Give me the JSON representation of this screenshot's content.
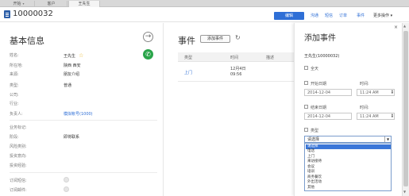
{
  "tabs": [
    {
      "label": "开始",
      "caret": "▾"
    },
    {
      "label": "客户"
    },
    {
      "label": "王先生"
    }
  ],
  "header": {
    "record_id": "10000032",
    "edit_label": "编辑",
    "links": [
      "沟通",
      "短信",
      "订单",
      "事件"
    ],
    "more_label": "更多操作 ▾"
  },
  "basic_info": {
    "title": "基本信息",
    "fields": [
      {
        "label": "姓名:",
        "value": "王先生"
      },
      {
        "label": "所在地:",
        "value": "陕西 西安"
      },
      {
        "label": "来源:",
        "value": "朋友介绍"
      },
      {
        "label": "类型:",
        "value": "普通"
      },
      {
        "label": "公司:",
        "value": ""
      },
      {
        "label": "行业:",
        "value": ""
      },
      {
        "label": "负责人:",
        "value": "模拟帐号(1000)"
      }
    ],
    "business_fields": [
      {
        "label": "业务标记:",
        "value": ""
      },
      {
        "label": "阶段:",
        "value": "即将联系"
      },
      {
        "label": "风险类别:",
        "value": ""
      },
      {
        "label": "投资意向:",
        "value": ""
      },
      {
        "label": "投资经验:",
        "value": ""
      }
    ],
    "subscription_fields": [
      {
        "label": "订阅短信:"
      },
      {
        "label": "订阅邮件:"
      }
    ]
  },
  "events": {
    "title": "事件",
    "add_label": "添加事件",
    "columns": [
      "类型",
      "时间",
      "描述"
    ],
    "rows": [
      {
        "type": "上门",
        "time": "12月4日",
        "time2": "09:56",
        "desc": ""
      }
    ]
  },
  "add_event_panel": {
    "title": "添加事件",
    "close_label": "×",
    "contact": "王先生(10000032)",
    "all_day_label": "全天",
    "start_date_label": "开始日期",
    "start_date": "2014-12-04",
    "start_time_label": "时间:",
    "start_time": "11:24 AM",
    "end_date_label": "结束日期",
    "end_date": "2014-12-04",
    "end_time_label": "时间:",
    "end_time": "11:24 AM",
    "type_label": "类型",
    "type_value": "请选择",
    "type_options": [
      "请选择",
      "电话",
      "上门",
      "来访接待",
      "会议",
      "培训",
      "商务餐饮",
      "外出活动",
      "其他"
    ]
  },
  "colors": {
    "accent": "#2f6fd6",
    "phone_green": "#2aa54a",
    "star_yellow": "#e8b21a",
    "dropdown_highlight": "#3a76d8"
  }
}
